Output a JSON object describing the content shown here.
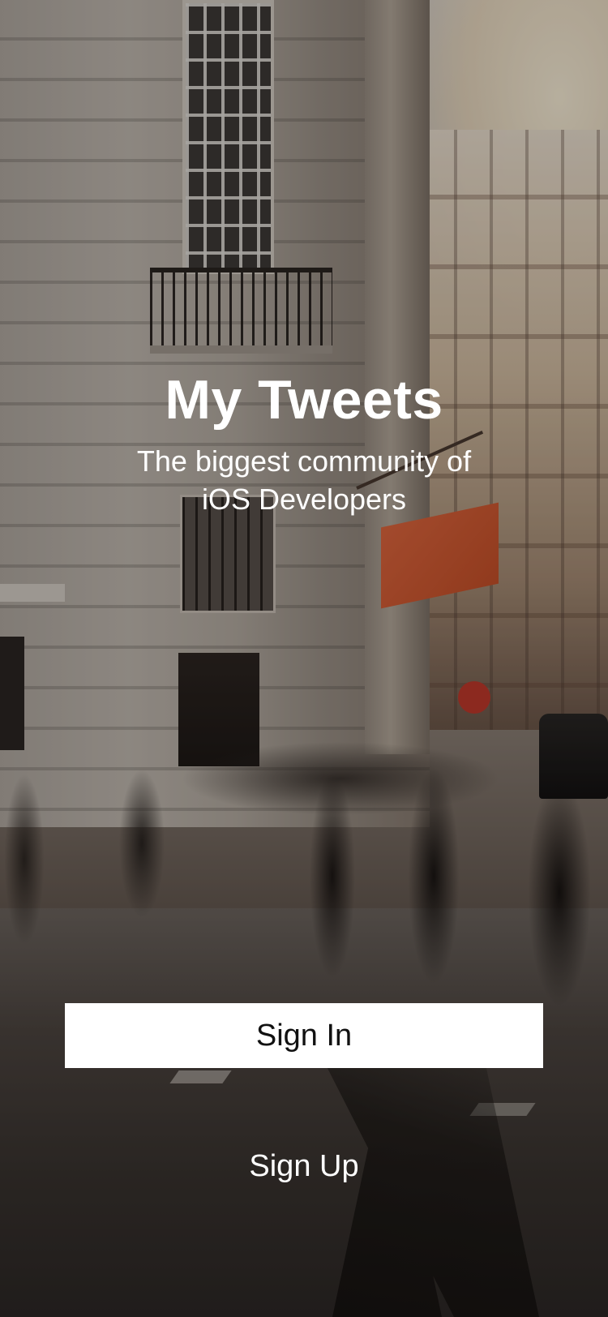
{
  "background": {
    "description_icon": "city-street-photo",
    "overlay_color": "#000000"
  },
  "header": {
    "title": "My Tweets",
    "subtitle_line1": "The biggest community of",
    "subtitle_line2": "iOS Developers"
  },
  "actions": {
    "sign_in_label": "Sign In",
    "sign_up_label": "Sign Up"
  },
  "colors": {
    "primary_text": "#FFFFFF",
    "button_background": "#FFFFFF",
    "button_text": "#111111"
  }
}
